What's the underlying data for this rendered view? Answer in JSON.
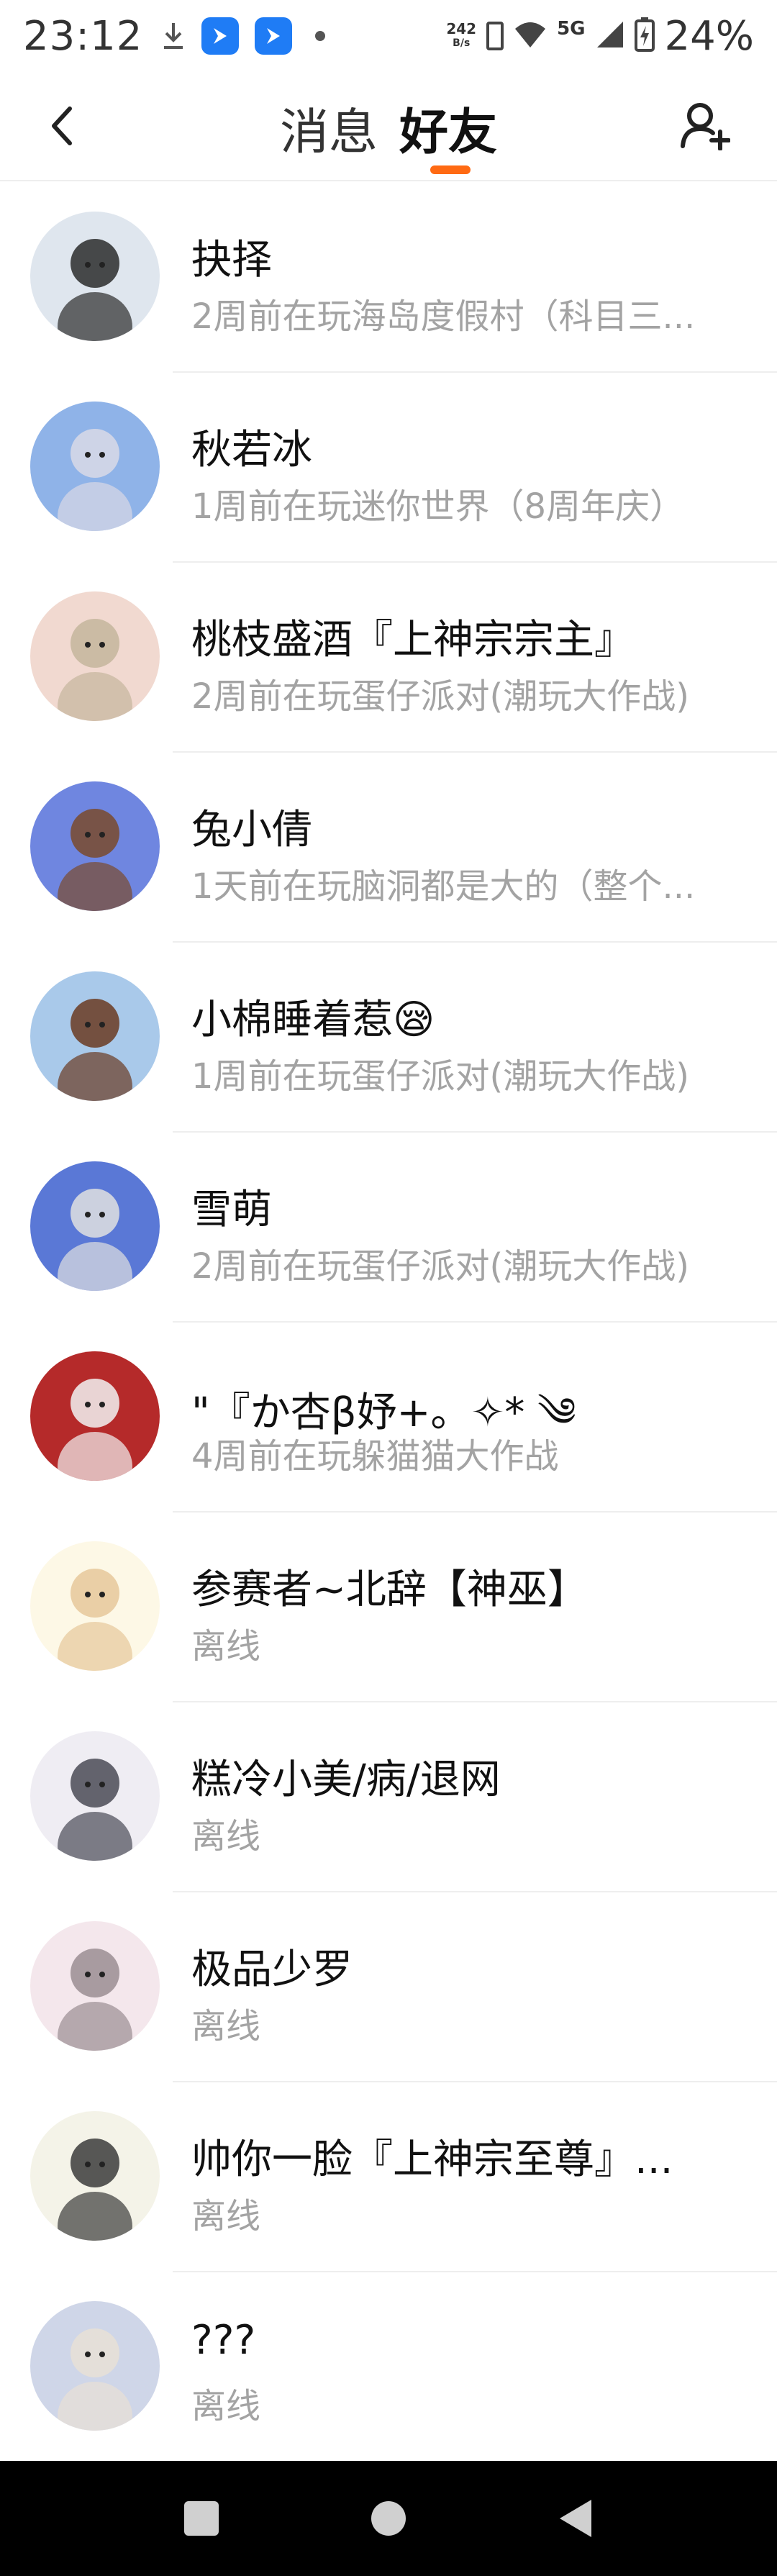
{
  "status_bar": {
    "time": "23:12",
    "net_speed": "242",
    "net_unit": "B/s",
    "network": "5G",
    "battery": "24%",
    "icons": [
      "download-icon",
      "app-notification-icon",
      "app-notification-icon",
      "dot-icon",
      "sim-icon",
      "wifi-icon",
      "signal-icon",
      "battery-charging-icon"
    ]
  },
  "header": {
    "tabs": [
      "消息",
      "好友"
    ],
    "active_tab": "好友",
    "accent_color": "#ff6a13"
  },
  "friends": [
    {
      "name": "抉择",
      "status": "2周前在玩海岛度假村（科目三...",
      "avatar_bg": "#dfe6ee",
      "avatar_fg": "#2b2b2b"
    },
    {
      "name": "秋若冰",
      "status": "1周前在玩迷你世界（8周年庆）",
      "avatar_bg": "#8fb3e8",
      "avatar_fg": "#d9d9e6"
    },
    {
      "name": "桃枝盛酒『上神宗宗主』",
      "status": "2周前在玩蛋仔派对(潮玩大作战)",
      "avatar_bg": "#f1d9d0",
      "avatar_fg": "#c4b59c"
    },
    {
      "name": "兔小倩",
      "status": "1天前在玩脑洞都是大的（整个...",
      "avatar_bg": "#6f86e0",
      "avatar_fg": "#7a4a2c"
    },
    {
      "name": "小棉睡着惹😪",
      "status": "1周前在玩蛋仔派对(潮玩大作战)",
      "avatar_bg": "#a9c9ea",
      "avatar_fg": "#6b3b22"
    },
    {
      "name": "雪萌",
      "status": "2周前在玩蛋仔派对(潮玩大作战)",
      "avatar_bg": "#5a78d6",
      "avatar_fg": "#e0e0e0"
    },
    {
      "name": "\"『か杏β妤+。✧* ༄",
      "status": "4周前在玩躲猫猫大作战",
      "avatar_bg": "#b52a2a",
      "avatar_fg": "#f2f2f2"
    },
    {
      "name": "参赛者~北辞【神巫】",
      "status": "离线",
      "avatar_bg": "#fdf8e6",
      "avatar_fg": "#e6c89a"
    },
    {
      "name": "糕冷小美/病/退网",
      "status": "离线",
      "avatar_bg": "#efedf3",
      "avatar_fg": "#4a4a55"
    },
    {
      "name": "极品少罗",
      "status": "离线",
      "avatar_bg": "#f4e7ec",
      "avatar_fg": "#9a8d93"
    },
    {
      "name": "帅你一脸『上神宗至尊』...",
      "status": "离线",
      "avatar_bg": "#f4f3e8",
      "avatar_fg": "#3b3b3b"
    },
    {
      "name": "???",
      "status": "离线",
      "avatar_bg": "#cfd6e8",
      "avatar_fg": "#e8e0d6"
    }
  ]
}
